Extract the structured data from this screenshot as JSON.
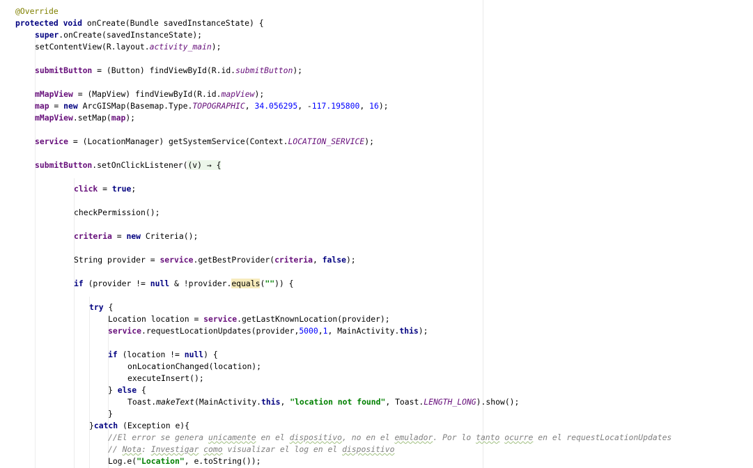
{
  "editor": {
    "lines": [
      {
        "indent": 22,
        "tokens": [
          {
            "t": "@Override",
            "c": "ann"
          }
        ]
      },
      {
        "indent": 22,
        "tokens": [
          {
            "t": "protected ",
            "c": "kw"
          },
          {
            "t": "void ",
            "c": "kw"
          },
          {
            "t": "onCreate(Bundle savedInstanceState) {"
          }
        ]
      },
      {
        "indent": 50,
        "tokens": [
          {
            "t": "super",
            "c": "kw"
          },
          {
            "t": ".onCreate(savedInstanceState);"
          }
        ]
      },
      {
        "indent": 50,
        "tokens": [
          {
            "t": "setContentView(R.layout."
          },
          {
            "t": "activity_main",
            "c": "sfld"
          },
          {
            "t": ");"
          }
        ]
      },
      {
        "indent": 0,
        "tokens": []
      },
      {
        "indent": 50,
        "tokens": [
          {
            "t": "submitButton",
            "c": "fld"
          },
          {
            "t": " = (Button) findViewById(R.id."
          },
          {
            "t": "submitButton",
            "c": "sfld"
          },
          {
            "t": ");"
          }
        ]
      },
      {
        "indent": 0,
        "tokens": []
      },
      {
        "indent": 50,
        "tokens": [
          {
            "t": "mMapView",
            "c": "fld"
          },
          {
            "t": " = (MapView) findViewById(R.id."
          },
          {
            "t": "mapView",
            "c": "sfld"
          },
          {
            "t": ");"
          }
        ]
      },
      {
        "indent": 50,
        "tokens": [
          {
            "t": "map",
            "c": "fld"
          },
          {
            "t": " = "
          },
          {
            "t": "new ",
            "c": "kw"
          },
          {
            "t": "ArcGISMap(Basemap.Type."
          },
          {
            "t": "TOPOGRAPHIC",
            "c": "sfld"
          },
          {
            "t": ", "
          },
          {
            "t": "34.056295",
            "c": "num"
          },
          {
            "t": ", -"
          },
          {
            "t": "117.195800",
            "c": "num"
          },
          {
            "t": ", "
          },
          {
            "t": "16",
            "c": "num"
          },
          {
            "t": ");"
          }
        ]
      },
      {
        "indent": 50,
        "tokens": [
          {
            "t": "mMapView",
            "c": "fld"
          },
          {
            "t": ".setMap("
          },
          {
            "t": "map",
            "c": "fld"
          },
          {
            "t": ");"
          }
        ]
      },
      {
        "indent": 0,
        "tokens": []
      },
      {
        "indent": 50,
        "tokens": [
          {
            "t": "service",
            "c": "fld"
          },
          {
            "t": " = (LocationManager) getSystemService(Context."
          },
          {
            "t": "LOCATION_SERVICE",
            "c": "sfld"
          },
          {
            "t": ");"
          }
        ]
      },
      {
        "indent": 0,
        "tokens": []
      },
      {
        "indent": 50,
        "tokens": [
          {
            "t": "submitButton",
            "c": "fld"
          },
          {
            "t": ".setOnClickListener("
          },
          {
            "t": "(v) → {",
            "c": "lam"
          }
        ]
      },
      {
        "indent": 0,
        "tokens": []
      },
      {
        "indent": 106,
        "tokens": [
          {
            "t": "click",
            "c": "fld"
          },
          {
            "t": " = "
          },
          {
            "t": "true",
            "c": "kw"
          },
          {
            "t": ";"
          }
        ]
      },
      {
        "indent": 0,
        "tokens": []
      },
      {
        "indent": 106,
        "tokens": [
          {
            "t": "checkPermission();"
          }
        ]
      },
      {
        "indent": 0,
        "tokens": []
      },
      {
        "indent": 106,
        "tokens": [
          {
            "t": "criteria",
            "c": "fld"
          },
          {
            "t": " = "
          },
          {
            "t": "new ",
            "c": "kw"
          },
          {
            "t": "Criteria();"
          }
        ]
      },
      {
        "indent": 0,
        "tokens": []
      },
      {
        "indent": 106,
        "tokens": [
          {
            "t": "String provider = "
          },
          {
            "t": "service",
            "c": "fld"
          },
          {
            "t": ".getBestProvider("
          },
          {
            "t": "criteria",
            "c": "fld"
          },
          {
            "t": ", "
          },
          {
            "t": "false",
            "c": "kw"
          },
          {
            "t": ");"
          }
        ]
      },
      {
        "indent": 0,
        "tokens": []
      },
      {
        "indent": 106,
        "tokens": [
          {
            "t": "if ",
            "c": "kw"
          },
          {
            "t": "(provider != "
          },
          {
            "t": "null ",
            "c": "kw"
          },
          {
            "t": "& !provider."
          },
          {
            "t": "equals",
            "c": "hl"
          },
          {
            "t": "("
          },
          {
            "t": "\"\"",
            "c": "str"
          },
          {
            "t": ")) {"
          }
        ]
      },
      {
        "indent": 0,
        "tokens": []
      },
      {
        "indent": 128,
        "tokens": [
          {
            "t": "try ",
            "c": "kw"
          },
          {
            "t": "{"
          }
        ]
      },
      {
        "indent": 155,
        "tokens": [
          {
            "t": "Location location = "
          },
          {
            "t": "service",
            "c": "fld"
          },
          {
            "t": ".getLastKnownLocation(provider);"
          }
        ]
      },
      {
        "indent": 155,
        "tokens": [
          {
            "t": "service",
            "c": "fld"
          },
          {
            "t": ".requestLocationUpdates(provider,"
          },
          {
            "t": "5000",
            "c": "num"
          },
          {
            "t": ","
          },
          {
            "t": "1",
            "c": "num"
          },
          {
            "t": ", MainActivity."
          },
          {
            "t": "this",
            "c": "kw"
          },
          {
            "t": ");"
          }
        ]
      },
      {
        "indent": 0,
        "tokens": []
      },
      {
        "indent": 155,
        "tokens": [
          {
            "t": "if ",
            "c": "kw"
          },
          {
            "t": "(location != "
          },
          {
            "t": "null",
            "c": "kw"
          },
          {
            "t": ") {"
          }
        ]
      },
      {
        "indent": 183,
        "tokens": [
          {
            "t": "onLocationChanged(location);"
          }
        ]
      },
      {
        "indent": 183,
        "tokens": [
          {
            "t": "executeInsert();"
          }
        ]
      },
      {
        "indent": 155,
        "tokens": [
          {
            "t": "} "
          },
          {
            "t": "else ",
            "c": "kw"
          },
          {
            "t": "{"
          }
        ]
      },
      {
        "indent": 183,
        "tokens": [
          {
            "t": "Toast."
          },
          {
            "t": "makeText",
            "c": "sfldp"
          },
          {
            "t": "(MainActivity."
          },
          {
            "t": "this",
            "c": "kw"
          },
          {
            "t": ", "
          },
          {
            "t": "\"location not found\"",
            "c": "str"
          },
          {
            "t": ", Toast."
          },
          {
            "t": "LENGTH_LONG",
            "c": "sfld"
          },
          {
            "t": ").show();"
          }
        ]
      },
      {
        "indent": 155,
        "tokens": [
          {
            "t": "}"
          }
        ]
      },
      {
        "indent": 128,
        "tokens": [
          {
            "t": "}"
          },
          {
            "t": "catch ",
            "c": "kw"
          },
          {
            "t": "(Exception e){"
          }
        ]
      },
      {
        "indent": 155,
        "tokens": [
          {
            "t": "//El error se genera ",
            "c": "cmt"
          },
          {
            "t": "unicamente",
            "c": "cmt typo"
          },
          {
            "t": " en el ",
            "c": "cmt"
          },
          {
            "t": "dispositivo",
            "c": "cmt typo"
          },
          {
            "t": ", no en el ",
            "c": "cmt"
          },
          {
            "t": "emulador",
            "c": "cmt typo"
          },
          {
            "t": ". Por lo ",
            "c": "cmt"
          },
          {
            "t": "tanto",
            "c": "cmt typo"
          },
          {
            "t": " ",
            "c": "cmt"
          },
          {
            "t": "ocurre",
            "c": "cmt typo"
          },
          {
            "t": " en el requestLocationUpdates",
            "c": "cmt"
          }
        ]
      },
      {
        "indent": 155,
        "tokens": [
          {
            "t": "// ",
            "c": "cmt"
          },
          {
            "t": "Nota",
            "c": "cmt typo"
          },
          {
            "t": ": ",
            "c": "cmt"
          },
          {
            "t": "Investigar",
            "c": "cmt typo"
          },
          {
            "t": " ",
            "c": "cmt"
          },
          {
            "t": "como",
            "c": "cmt typo"
          },
          {
            "t": " visualizar el log en el ",
            "c": "cmt"
          },
          {
            "t": "dispositivo",
            "c": "cmt typo"
          }
        ]
      },
      {
        "indent": 155,
        "tokens": [
          {
            "t": "Log.e("
          },
          {
            "t": "\"Location\"",
            "c": "str"
          },
          {
            "t": ", e.toString());"
          }
        ]
      }
    ]
  }
}
